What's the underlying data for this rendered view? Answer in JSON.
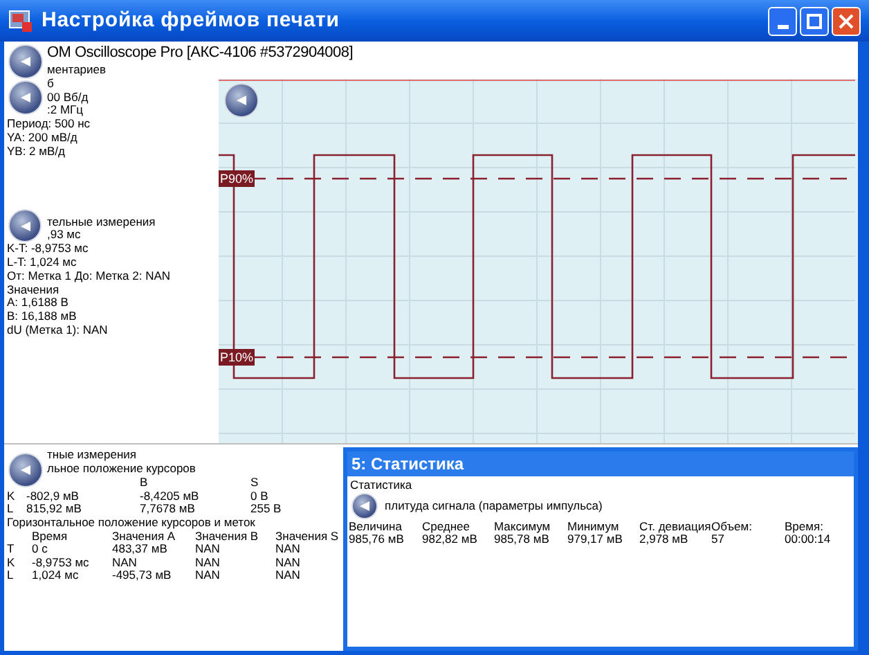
{
  "window": {
    "title": "Настройка фреймов печати"
  },
  "header": {
    "text": "OM Oscilloscope Pro [АКС-4106 #5372904008]"
  },
  "info_panel": {
    "lines_beside_buttons": [
      "ментариев",
      "б",
      "00 Вб/д",
      ":2 МГц"
    ],
    "lines": [
      "Период: 500 нс",
      "YA: 200 мВ/д",
      "YB: 2 мВ/д"
    ]
  },
  "measurements_panel": {
    "lines_beside_buttons": [
      "тельные измерения",
      ",93 мс"
    ],
    "lines": [
      "K-T: -8,9753 мс",
      "L-T: 1,024 мс",
      "От: Метка 1 До: Метка 2: NAN",
      "Значения",
      "A: 1,6188 В",
      "B: 16,188 мВ",
      "dU (Метка 1): NAN"
    ]
  },
  "plot": {
    "markers": [
      {
        "label": "P90%"
      },
      {
        "label": "P10%"
      }
    ]
  },
  "cursor_panel": {
    "lines": [
      "тные измерения",
      "льное положение курсоров"
    ],
    "vertical_table": {
      "columns": [
        "",
        "B",
        "S"
      ],
      "rows": [
        {
          "label": "K",
          "cells": [
            "-802,9 мВ",
            "-8,4205 мВ",
            "0 В"
          ]
        },
        {
          "label": "L",
          "cells": [
            "815,92 мВ",
            "7,7678 мВ",
            "255 В"
          ]
        }
      ]
    },
    "horizontal_heading": "Горизонтальное положение курсоров и меток",
    "horizontal_table": {
      "columns": [
        "Время",
        "Значения A",
        "Значения B",
        "Значения S"
      ],
      "rows": [
        {
          "label": "T",
          "cells": [
            "0 с",
            "483,37 мВ",
            "NAN",
            "NAN"
          ]
        },
        {
          "label": "K",
          "cells": [
            "-8,9753 мс",
            "NAN",
            "NAN",
            "NAN"
          ]
        },
        {
          "label": "L",
          "cells": [
            "1,024 мс",
            "-495,73 мВ",
            "NAN",
            "NAN"
          ]
        }
      ]
    }
  },
  "stats_panel": {
    "title": "5: Статистика",
    "heading": "Статистика",
    "subheading": "плитуда сигнала (параметры импульса)",
    "columns": [
      "Величина",
      "Среднее",
      "Максимум",
      "Минимум",
      "Ст. девиация",
      "Объем:",
      "Время:"
    ],
    "values": [
      "985,76 мВ",
      "982,82 мВ",
      "985,78 мВ",
      "979,17 мВ",
      "2,978 мВ",
      "57",
      "00:00:14"
    ]
  }
}
